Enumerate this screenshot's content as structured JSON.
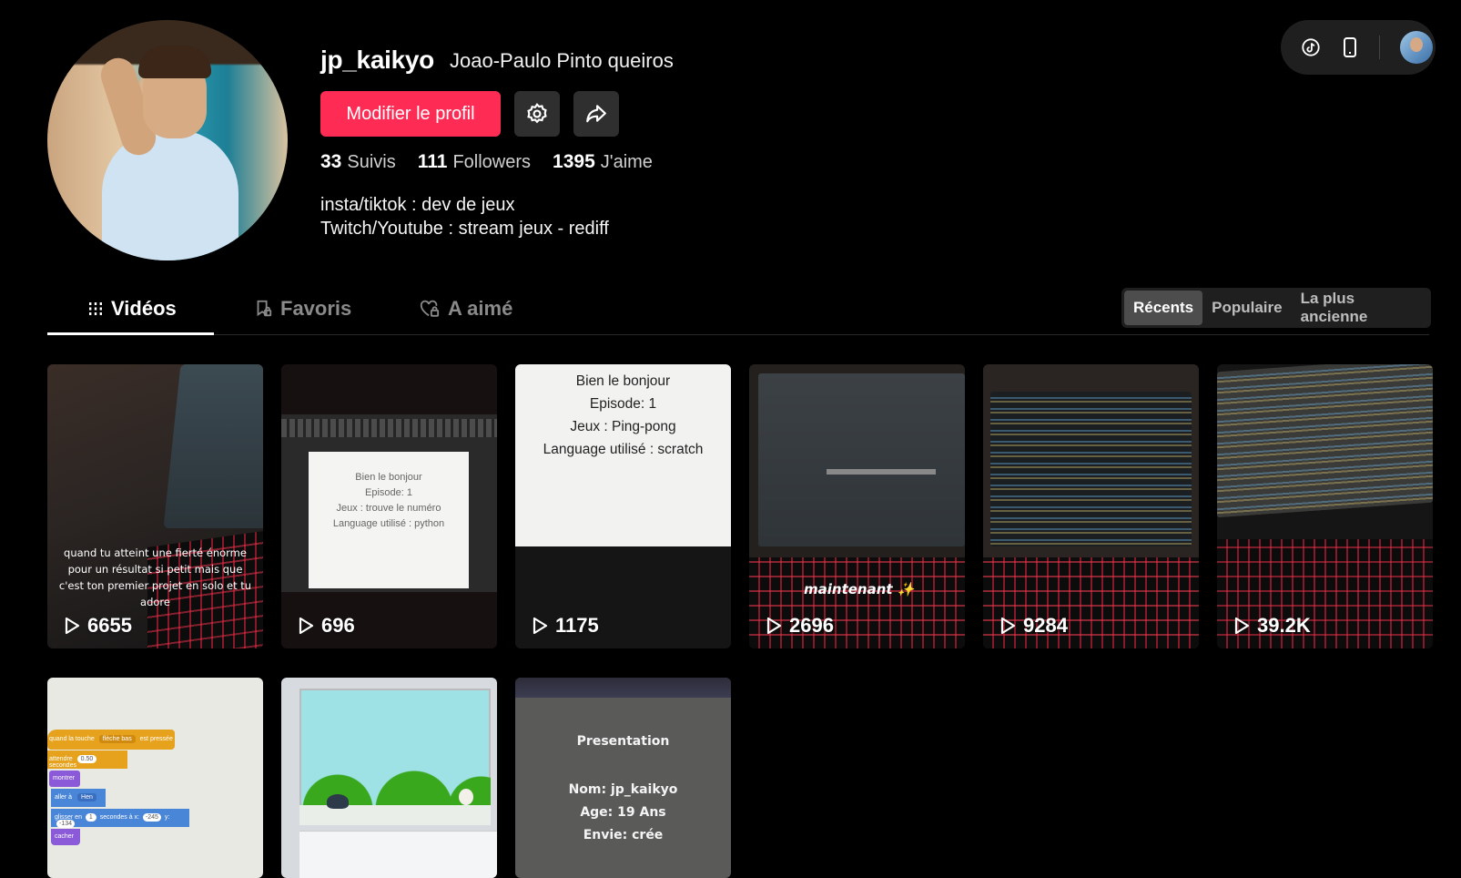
{
  "profile": {
    "username": "jp_kaikyo",
    "fullname": "Joao-Paulo Pinto queiros",
    "edit_label": "Modifier le profil",
    "stats": {
      "following_count": "33",
      "following_label": "Suivis",
      "followers_count": "111",
      "followers_label": "Followers",
      "likes_count": "1395",
      "likes_label": "J'aime"
    },
    "bio": [
      "insta/tiktok : dev de jeux",
      "Twitch/Youtube : stream jeux - rediff"
    ]
  },
  "tabs": {
    "videos": "Vidéos",
    "favorites": "Favoris",
    "liked": "A aimé"
  },
  "sort": {
    "recent": "Récents",
    "popular": "Populaire",
    "oldest": "La plus ancienne"
  },
  "videos": [
    {
      "views": "6655",
      "caption": "quand tu atteint une fierté énorme pour un résultat si petit mais que c'est ton premier projet en solo et tu adore"
    },
    {
      "views": "696",
      "text": [
        "Bien le bonjour",
        "Episode: 1",
        "Jeux : trouve le numéro",
        "Language utilisé : python"
      ]
    },
    {
      "views": "1175",
      "text": [
        "Bien le bonjour",
        "Episode: 1",
        "Jeux : Ping-pong",
        "Language utilisé : scratch"
      ]
    },
    {
      "views": "2696",
      "caption": "maintenant ✨"
    },
    {
      "views": "9284"
    },
    {
      "views": "39.2K"
    },
    {
      "views": "",
      "blocks": [
        "quand la touche",
        "flèche bas",
        "est pressée",
        "attendre",
        "0.50",
        "secondes",
        "montrer",
        "aller à",
        "Hen",
        "glisser en",
        "1",
        "secondes à x:",
        "-245",
        "y:",
        "-134",
        "cacher"
      ]
    },
    {
      "views": ""
    },
    {
      "views": "",
      "text": [
        "Presentation",
        "Nom: jp_kaikyo",
        "Age: 19 Ans",
        "Envie: crée"
      ]
    }
  ],
  "colors": {
    "accent": "#fe2c55",
    "background": "#000000",
    "panel": "#1f1f1f"
  }
}
